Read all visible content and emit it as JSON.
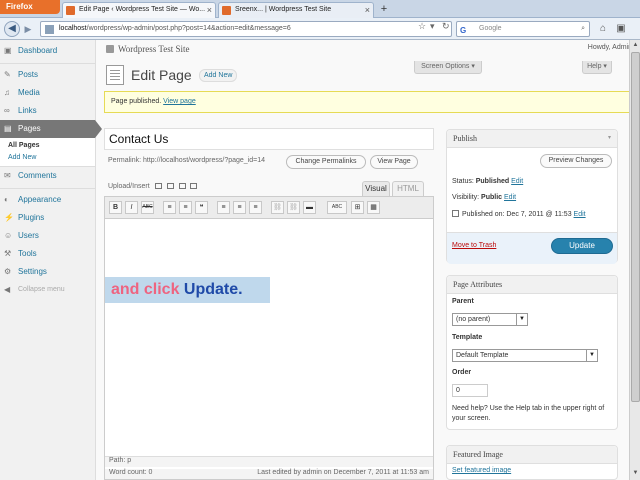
{
  "browser": {
    "firefox_label": "Firefox",
    "tabs": [
      {
        "title": "Edit Page ‹ Wordpress Test Site — Wo...",
        "close": "×"
      },
      {
        "title": "Sreenx... | Wordpress Test Site",
        "close": "×"
      }
    ],
    "new_tab": "+",
    "url_host": "localhost",
    "url_rest": "/wordpress/wp-admin/post.php?post=14&action=edit&message=6",
    "search_placeholder": "Google",
    "search_engine_icon": "G"
  },
  "wp": {
    "site_title": "Wordpress Test Site",
    "howdy": "Howdy, Admin",
    "screen_options": "Screen Options ▾",
    "help": "Help ▾",
    "menu": [
      {
        "icon": "▣",
        "label": "Dashboard"
      },
      {
        "icon": "✎",
        "label": "Posts"
      },
      {
        "icon": "♫",
        "label": "Media"
      },
      {
        "icon": "∞",
        "label": "Links"
      },
      {
        "icon": "▤",
        "label": "Pages"
      },
      {
        "icon": "✉",
        "label": "Comments"
      },
      {
        "icon": "◐",
        "label": "Appearance"
      },
      {
        "icon": "⚡",
        "label": "Plugins"
      },
      {
        "icon": "☺",
        "label": "Users"
      },
      {
        "icon": "⚒",
        "label": "Tools"
      },
      {
        "icon": "⚙",
        "label": "Settings"
      },
      {
        "icon": "◀",
        "label": "Collapse menu"
      }
    ],
    "submenu": [
      "All Pages",
      "Add New"
    ],
    "page_heading": "Edit Page",
    "add_new": "Add New",
    "notice_text": "Page published.",
    "notice_link": "View page",
    "post_title": "Contact Us",
    "permalink": "Permalink: http://localhost/wordpress/?page_id=14",
    "change_permalinks": "Change Permalinks",
    "view_page": "View Page",
    "upload_insert": "Upload/Insert",
    "tab_visual": "Visual",
    "tab_html": "HTML",
    "toolbar": [
      "B",
      "I",
      "ABC",
      "≡",
      "≡",
      "❝",
      "≡",
      "≡",
      "≡",
      "⛓",
      "⛓",
      "▬",
      "ABC",
      "⊞",
      "▦"
    ],
    "caption_part1": "and click ",
    "caption_part2": "Update.",
    "path_label": "Path: p",
    "word_count": "Word count: 0",
    "last_edited": "Last edited by admin on December 7, 2011 at 11:53 am",
    "publish": {
      "title": "Publish",
      "preview": "Preview Changes",
      "status_label": "Status: ",
      "status_value": "Published",
      "status_edit": "Edit",
      "visibility_label": "Visibility: ",
      "visibility_value": "Public",
      "visibility_edit": "Edit",
      "published_on": "Published on: Dec 7, 2011 @ 11:53",
      "published_edit": "Edit",
      "trash": "Move to Trash",
      "update": "Update"
    },
    "attributes": {
      "title": "Page Attributes",
      "parent_label": "Parent",
      "parent_value": "(no parent)",
      "template_label": "Template",
      "template_value": "Default Template",
      "order_label": "Order",
      "order_value": "0",
      "help": "Need help? Use the Help tab in the upper right of your screen."
    },
    "featured": {
      "title": "Featured Image",
      "link": "Set featured image"
    }
  }
}
